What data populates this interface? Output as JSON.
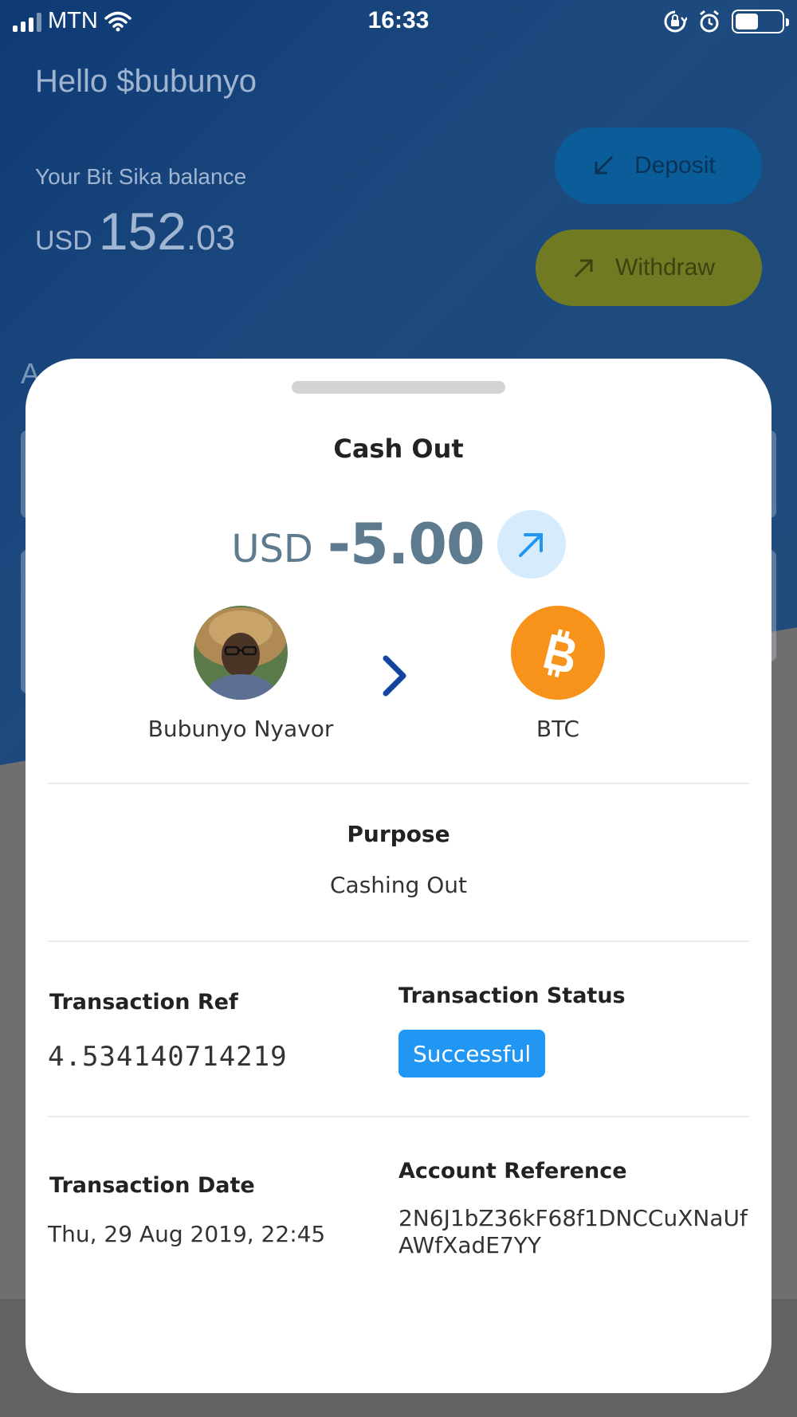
{
  "status_bar": {
    "carrier": "MTN",
    "time": "16:33"
  },
  "background": {
    "greeting": "Hello $bubunyo",
    "balance_label": "Your Bit Sika balance",
    "balance_currency": "USD",
    "balance_integer": "152",
    "balance_decimal": ".03",
    "deposit_label": "Deposit",
    "withdraw_label": "Withdraw",
    "section_letter": "A"
  },
  "sheet": {
    "title": "Cash Out",
    "amount_currency": "USD",
    "amount_value": "-5.00",
    "from_name": "Bubunyo Nyavor",
    "to_name": "BTC",
    "purpose_label": "Purpose",
    "purpose_value": "Cashing Out",
    "transaction_ref_label": "Transaction Ref",
    "transaction_ref_value": "4.534140714219",
    "transaction_status_label": "Transaction Status",
    "transaction_status_value": "Successful",
    "transaction_date_label": "Transaction Date",
    "transaction_date_value": "Thu, 29 Aug 2019, 22:45",
    "account_reference_label": "Account Reference",
    "account_reference_value": "2N6J1bZ36kF68f1DNCCuXNaUfAWfXadE7YY"
  },
  "colors": {
    "status_success": "#2196f3",
    "amount_text": "#5e7a8e",
    "btc_orange": "#f7931a",
    "chevron_blue": "#1446a0"
  },
  "icons": [
    "wifi-icon",
    "rotation-lock-icon",
    "alarm-icon",
    "battery-icon",
    "arrow-down-left-icon",
    "arrow-up-right-icon",
    "chevron-right-icon",
    "bitcoin-icon"
  ]
}
